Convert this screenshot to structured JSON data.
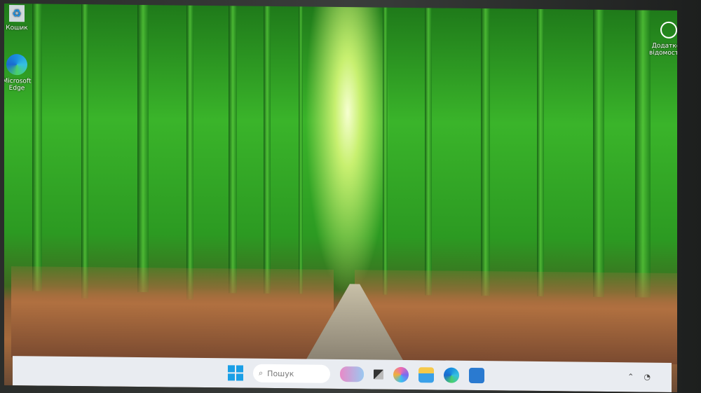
{
  "desktop": {
    "icons": [
      {
        "label": "Кошик",
        "icon": "recycle-bin-icon"
      },
      {
        "label": "Microsoft Edge",
        "icon": "edge-icon"
      }
    ],
    "info_widget": {
      "label": "Додаткові відомості ...",
      "icon": "spotlight-icon"
    }
  },
  "taskbar": {
    "search_placeholder": "Пошук",
    "apps": [
      "widgets",
      "task-view",
      "copilot",
      "file-explorer",
      "edge",
      "store"
    ]
  },
  "colors": {
    "taskbar": "#e9ecf1",
    "accent": "#1a8fe0"
  }
}
